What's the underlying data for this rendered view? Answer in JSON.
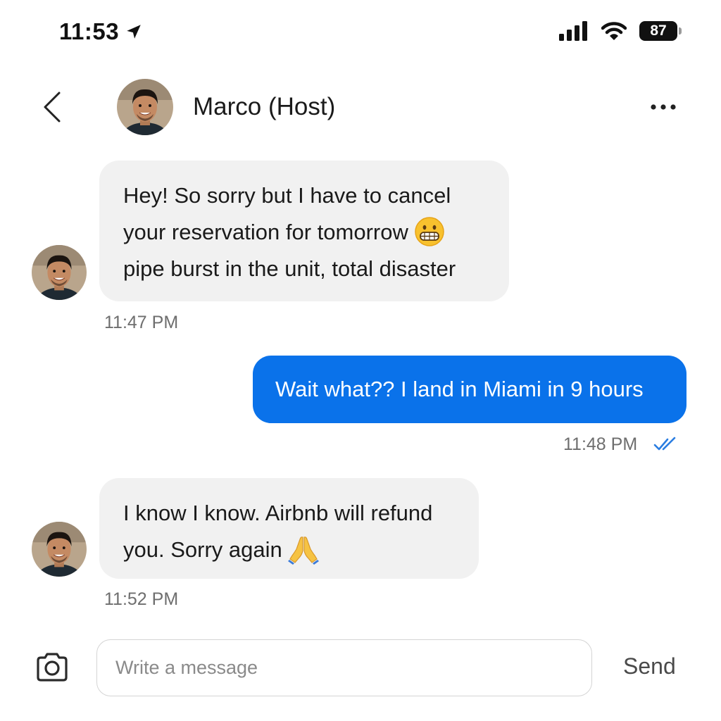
{
  "status_bar": {
    "time": "11:53",
    "battery": "87",
    "icons": [
      "location-arrow-icon",
      "signal-icon",
      "wifi-icon",
      "battery-icon"
    ]
  },
  "header": {
    "contact_name": "Marco (Host)",
    "back_icon": "chevron-left-icon",
    "more_icon": "more-horizontal-icon"
  },
  "messages": [
    {
      "direction": "incoming",
      "lines": [
        "Hey! So sorry but I have to cancel",
        "your reservation for tomorrow",
        "pipe burst in the unit, total disaster"
      ],
      "emoji": "grimacing-face-emoji",
      "time": "11:47 PM"
    },
    {
      "direction": "outgoing",
      "lines": [
        "Wait what?? I land in Miami in 9 hours"
      ],
      "time": "11:48 PM",
      "read_icon": "double-check-icon"
    },
    {
      "direction": "incoming",
      "lines": [
        "I know I know. Airbnb will refund",
        "you. Sorry again"
      ],
      "emoji": "folded-hands-emoji",
      "time": "11:52 PM"
    }
  ],
  "composer": {
    "placeholder": "Write a message",
    "value": "",
    "send_label": "Send",
    "camera_icon": "camera-icon"
  },
  "colors": {
    "outgoing_bubble": "#0a72ea",
    "incoming_bubble": "#f1f1f1",
    "read_receipt": "#2a7de1"
  }
}
